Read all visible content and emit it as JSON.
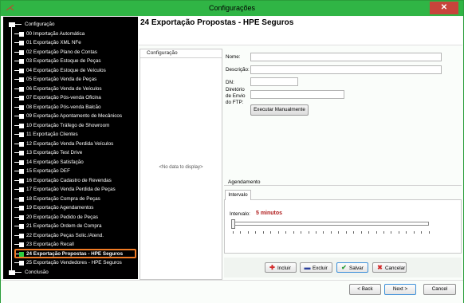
{
  "window": {
    "title": "Configurações",
    "close_symbol": "✕"
  },
  "tree": {
    "root_label": "Configuração",
    "items": [
      "00 Importação Automática",
      "01 Exportação XML NFe",
      "02 Exportação Plano de Contas",
      "03 Exportação Estoque de Peças",
      "04 Exportação Estoque de Veículos",
      "05 Exportação Venda de Peças",
      "06 Exportação Venda de Veículos",
      "07 Exportação Pós-venda Oficina",
      "08 Exportação Pós-venda Balcão",
      "09 Exportação Apontamento de Mecânicos",
      "10 Exportação Tráfego de Showroom",
      "11 Exportação Clientes",
      "12 Exportação Venda Perdida Veículos",
      "13 Exportação Test Drive",
      "14 Exportação Satisfação",
      "15 Exportação DEF",
      "16 Exportação Cadastro de Revendas",
      "17 Exportação Venda Perdida de Peças",
      "18 Exportação Compra de Peças",
      "19 Exportação Agendamentos",
      "20 Exportação Pedido de Peças",
      "21 Exportação Ordem de Compra",
      "22 Exportação Peças Solic./Atend.",
      "23 Exportação Recall",
      "24 Exportação Propostas - HPE Seguros",
      "25 Exportação Vendedores - HPE Seguros"
    ],
    "selected_index": 24,
    "end_label": "Conclusão"
  },
  "page_title": "24 Exportação Propostas - HPE Seguros",
  "config_list": {
    "column_header": "Configuração",
    "empty_text": "<No data to display>"
  },
  "form": {
    "nome_label": "Nome:",
    "nome_value": "",
    "descricao_label": "Descrição:",
    "descricao_value": "",
    "dn_label": "DN:",
    "dn_value": "",
    "diretorio_label_1": "Diretório",
    "diretorio_label_2": "de Envio",
    "diretorio_label_3": "do FTP:",
    "diretorio_value": "",
    "executar_button": "Executar Manualmente"
  },
  "agendamento": {
    "title": "Agendamento",
    "tab_label": "Intervalo",
    "intervalo_label": "Intervalo:",
    "intervalo_value": "5 minutos",
    "slider_level": 0
  },
  "actions": {
    "incluir": "Incluir",
    "excluir": "Excluir",
    "salvar": "Salvar",
    "cancelar": "Cancelar"
  },
  "nav": {
    "back": "< Back",
    "next": "Next >",
    "cancel": "Cancel"
  },
  "colors": {
    "titlebar": "#30b545",
    "selection_border": "#f07a24",
    "interval_value": "#b01c1c",
    "tree_bg": "#000000"
  }
}
